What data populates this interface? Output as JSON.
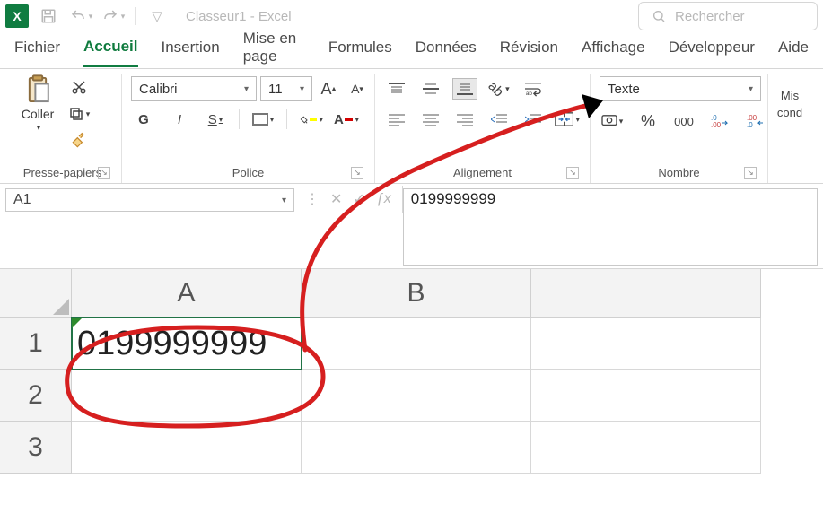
{
  "titlebar": {
    "doc_title": "Classeur1 - Excel",
    "search_placeholder": "Rechercher"
  },
  "tabs": {
    "items": [
      {
        "label": "Fichier"
      },
      {
        "label": "Accueil"
      },
      {
        "label": "Insertion"
      },
      {
        "label": "Mise en page"
      },
      {
        "label": "Formules"
      },
      {
        "label": "Données"
      },
      {
        "label": "Révision"
      },
      {
        "label": "Affichage"
      },
      {
        "label": "Développeur"
      },
      {
        "label": "Aide"
      }
    ],
    "active_index": 1
  },
  "ribbon": {
    "clipboard": {
      "paste_label": "Coller",
      "group_label": "Presse-papiers"
    },
    "font": {
      "group_label": "Police",
      "name": "Calibri",
      "size": "11",
      "bold": "G",
      "italic": "I",
      "underline": "S"
    },
    "alignment": {
      "group_label": "Alignement"
    },
    "number": {
      "group_label": "Nombre",
      "format": "Texte",
      "decimals_label": "000"
    },
    "extras": {
      "mis_label": "Mis",
      "cond_label": "cond"
    }
  },
  "formula_bar": {
    "cell_ref": "A1",
    "formula": "0199999999"
  },
  "grid": {
    "col_headers": [
      "A",
      "B"
    ],
    "row_headers": [
      "1",
      "2",
      "3"
    ],
    "cells": {
      "A1": "0199999999"
    }
  }
}
